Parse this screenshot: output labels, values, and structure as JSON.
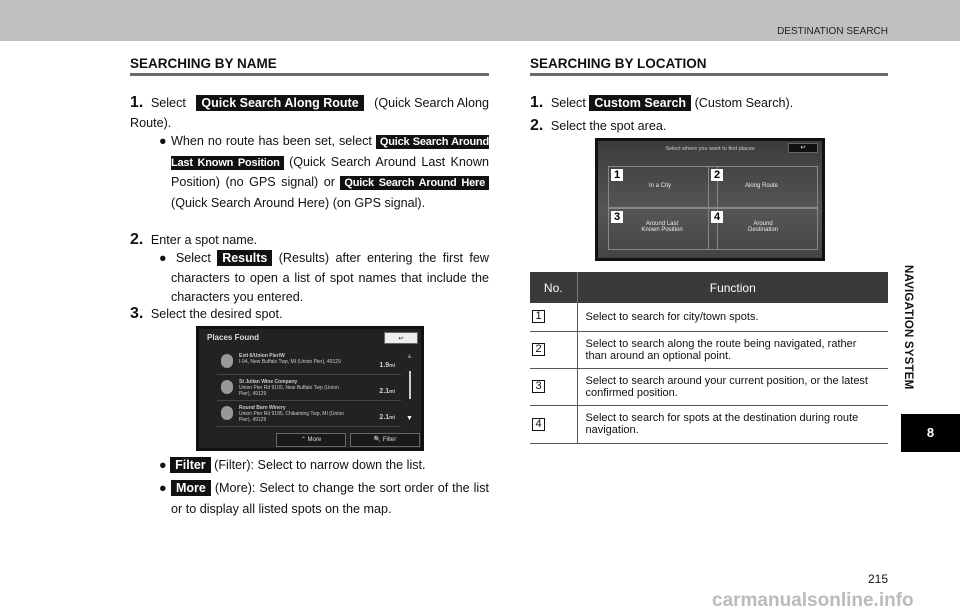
{
  "header": {
    "section": "DESTINATION SEARCH"
  },
  "left": {
    "title": "SEARCHING BY NAME",
    "step1": {
      "num": "1.",
      "pre": "Select",
      "key": "Quick Search Along Route",
      "post": "(Quick Search Along Route).",
      "bullet_pre": "When no route has been set, select",
      "key2": "Quick Search Around Last Known Position",
      "mid": "(Quick Search Around Last Known Position) (no GPS signal) or",
      "key3": "Quick Search Around Here",
      "post2": "(Quick Search Around Here) (on GPS signal)."
    },
    "step2": {
      "num": "2.",
      "text": "Enter a spot name.",
      "bullet_pre": "Select",
      "key": "Results",
      "bullet_post": "(Results) after entering the first few characters to open a list of spot names that include the characters you entered."
    },
    "step3": {
      "num": "3.",
      "text": "Select the desired spot."
    },
    "screen": {
      "title": "Places Found",
      "items": [
        {
          "name": "Exit 6/Union Pier/W",
          "addr": "I-94, New Buffalo Twp, MI (Union Pier), 49129",
          "dist": "1.9",
          "unit": "mi"
        },
        {
          "name": "St Julian Wine Company",
          "addr": "Union Pier Rd 9100, New Buffalo Twp (Union Pier), 49129",
          "dist": "2.1",
          "unit": "mi"
        },
        {
          "name": "Round Barn Winery",
          "addr": "Union Pier Rd 9185, Chikaming Twp, MI (Union Pier), 49129",
          "dist": "2.1",
          "unit": "mi"
        }
      ],
      "more": "More",
      "filter": "Filter"
    },
    "bullets": [
      {
        "key": "Filter",
        "text": "(Filter): Select to narrow down the list."
      },
      {
        "key": "More",
        "text": "(More): Select to change the sort order of the list or to display all listed spots on the map."
      }
    ]
  },
  "right": {
    "title": "SEARCHING BY LOCATION",
    "step1": {
      "num": "1.",
      "pre": "Select",
      "key": "Custom Search",
      "post": "(Custom Search)."
    },
    "step2": {
      "num": "2.",
      "text": "Select the spot area."
    },
    "screen": {
      "title": "Select where you want to find places",
      "cells": [
        {
          "n": "1",
          "label": "In a City"
        },
        {
          "n": "2",
          "label": "Along Route"
        },
        {
          "n": "3",
          "label": "Around Last Known Position"
        },
        {
          "n": "4",
          "label": "Around Destination"
        }
      ]
    },
    "table": {
      "headers": [
        "No.",
        "Function"
      ],
      "rows": [
        {
          "n": "1",
          "text": "Select to search for city/town spots."
        },
        {
          "n": "2",
          "text": "Select to search along the route being navigated, rather than around an optional point."
        },
        {
          "n": "3",
          "text": "Select to search around your current position, or the latest confirmed position."
        },
        {
          "n": "4",
          "text": "Select to search for spots at the destination during route navigation."
        }
      ]
    }
  },
  "side": {
    "tab": "NAVIGATION SYSTEM",
    "chapter": "8"
  },
  "page_number": "215",
  "watermark": "carmanualsonline.info"
}
